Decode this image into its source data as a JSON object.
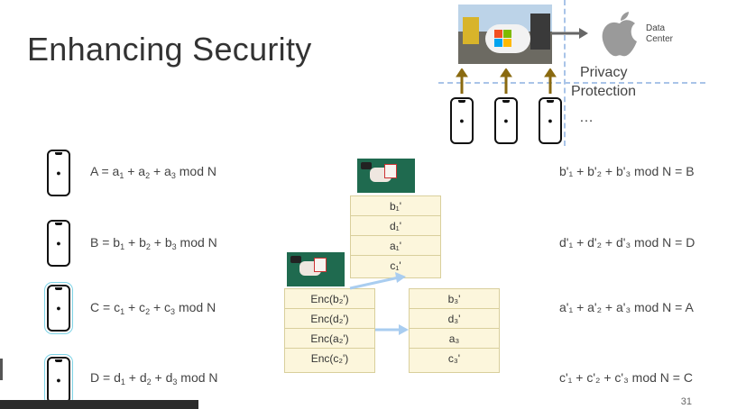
{
  "slide": {
    "title": "Enhancing Security",
    "page_number": "31",
    "ellipsis": "…",
    "privacy_line1": "Privacy",
    "privacy_line2": "Protection",
    "data_center_line1": "Data",
    "data_center_line2": "Center"
  },
  "equations_left": [
    {
      "parts": [
        "A = a",
        "1",
        " + a",
        "2",
        " + a",
        "3",
        " mod N"
      ]
    },
    {
      "parts": [
        "B = b",
        "1",
        " + b",
        "2",
        " + b",
        "3",
        " mod N"
      ]
    },
    {
      "parts": [
        "C = c",
        "1",
        " + c",
        "2",
        " + c",
        "3",
        " mod N"
      ]
    },
    {
      "parts": [
        "D = d",
        "1",
        " + d",
        "2",
        " + d",
        "3",
        " mod N"
      ]
    }
  ],
  "equations_right": [
    {
      "text": "b'₁ + b'₂ + b'₃ mod N = B"
    },
    {
      "text": "d'₁ + d'₂ + d'₃ mod N = D"
    },
    {
      "text": "a'₁ + a'₂ + a'₃ mod N = A"
    },
    {
      "text": "c'₁ + c'₂ + c'₃ mod N = C"
    }
  ],
  "stack_top": [
    "b₁'",
    "d₁'",
    "a₁'",
    "c₁'"
  ],
  "stack_enc": [
    "Enc(b₂')",
    "Enc(d₂')",
    "Enc(a₂')",
    "Enc(c₂')"
  ],
  "stack_right": [
    "b₃'",
    "d₃'",
    "a₃",
    "c₃'"
  ],
  "icons": {
    "phone": "smartphone-icon",
    "apple": "apple-logo-icon"
  },
  "colors": {
    "cell_bg": "#fcf6dc",
    "dash": "#a9c4e8",
    "arrow": "#a9cdf0",
    "highlight": "#7ed3e6"
  }
}
